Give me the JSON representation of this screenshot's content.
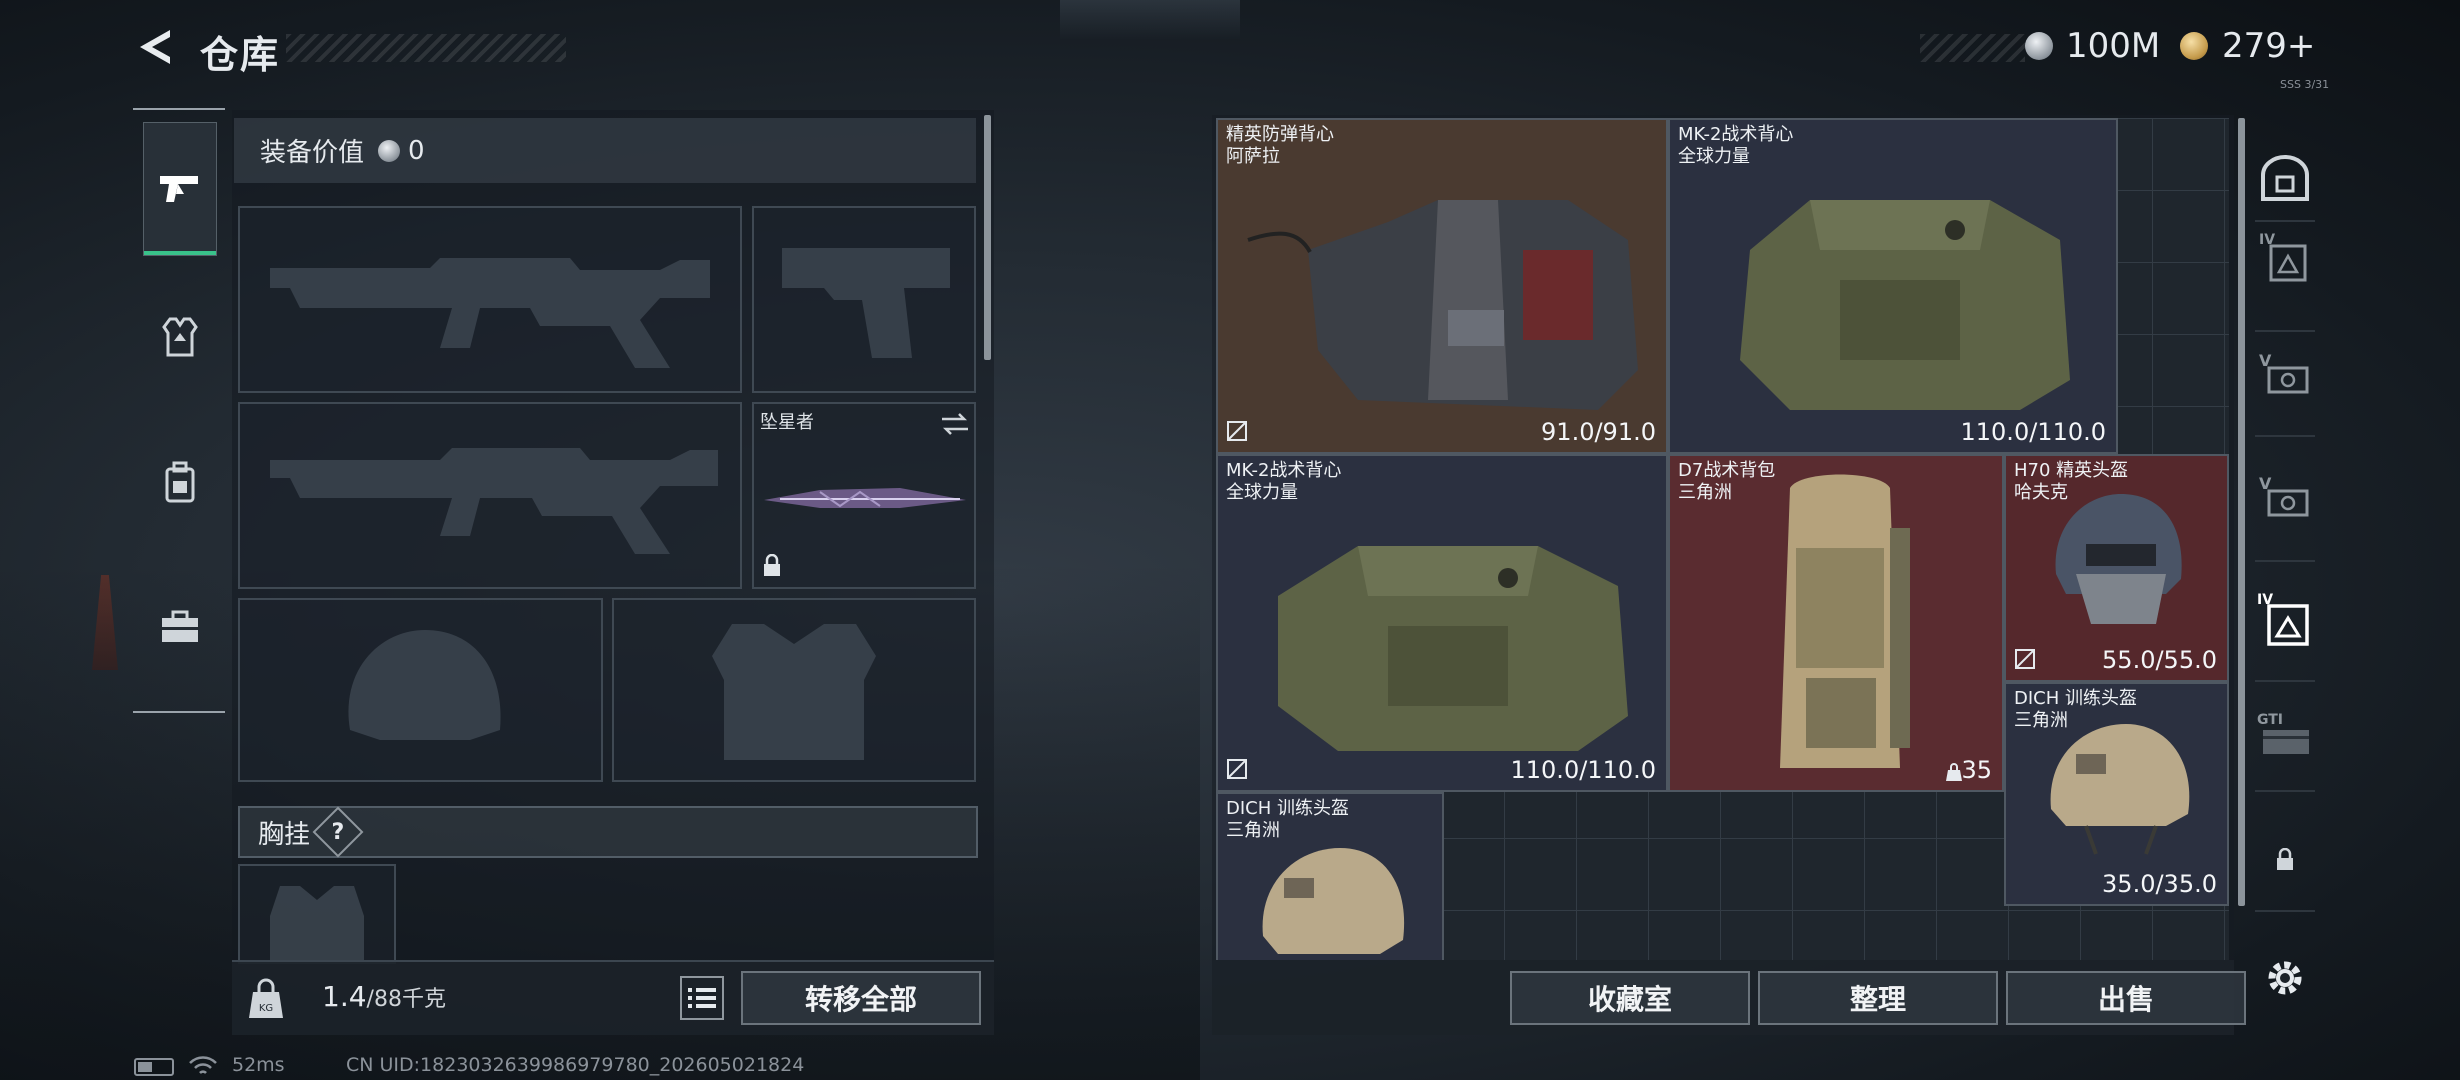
{
  "header": {
    "title": "仓库",
    "silver_amount": "100M",
    "gold_amount": "279+",
    "tiny_note": "SSS 3/31"
  },
  "loadout": {
    "value_label": "装备价值",
    "value": "0",
    "melee_name": "坠星者",
    "chest_rig_label": "胸挂",
    "chest_rig_help": "?"
  },
  "footer_left": {
    "weight": "1.4",
    "capacity": "/88千克",
    "transfer_all": "转移全部"
  },
  "items": [
    {
      "name": "精英防弹背心",
      "maker": "阿萨拉",
      "durability": "91.0/91.0"
    },
    {
      "name": "MK-2战术背心",
      "maker": "全球力量",
      "durability": "110.0/110.0"
    },
    {
      "name": "MK-2战术背心",
      "maker": "全球力量",
      "durability": "110.0/110.0"
    },
    {
      "name": "D7战术背包",
      "maker": "三角洲",
      "count": "35"
    },
    {
      "name": "H70 精英头盔",
      "maker": "哈夫克",
      "durability": "55.0/55.0"
    },
    {
      "name": "DICH 训练头盔",
      "maker": "三角洲",
      "durability": "35.0/35.0"
    },
    {
      "name": "DICH 训练头盔",
      "maker": "三角洲"
    }
  ],
  "footer_right": {
    "collection": "收藏室",
    "organize": "整理",
    "sell": "出售"
  },
  "status_bar": {
    "ping": "52ms",
    "uid": "CN UID:1823032639986979780_202605021824"
  },
  "right_nav": {
    "tier4": "IV",
    "tier5a": "V",
    "tier5b": "V",
    "tier4b": "IV",
    "gti": "GTI"
  },
  "colors": {
    "accent_green": "#39c28a",
    "vest_elite_bg": "#4a3a30",
    "backpack_bg": "#5a2c30",
    "helmet_elite_bg": "#55282c",
    "navy_bg": "#2b3040"
  }
}
